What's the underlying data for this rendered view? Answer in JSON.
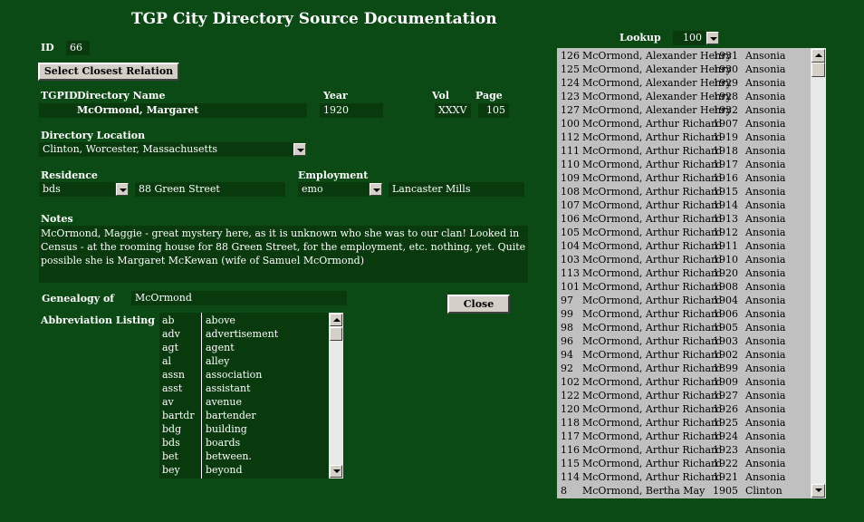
{
  "title": "TGP City Directory Source Documentation",
  "id": {
    "label": "ID",
    "value": "66"
  },
  "buttons": {
    "select_closest": "Select Closest Relation",
    "close": "Close"
  },
  "headers": {
    "tgpid": "TGPID",
    "directory_name": "Directory Name",
    "year": "Year",
    "vol": "Vol",
    "page": "Page"
  },
  "record": {
    "directory_name": "McOrmond, Margaret",
    "year": "1920",
    "vol": "XXXV",
    "page": "105"
  },
  "location": {
    "label": "Directory Location",
    "value": "Clinton, Worcester, Massachusetts"
  },
  "residence": {
    "label": "Residence",
    "type": "bds",
    "address": "88 Green Street"
  },
  "employment": {
    "label": "Employment",
    "type": "emo",
    "employer": "Lancaster Mills"
  },
  "notes": {
    "label": "Notes",
    "text": "McOrmond, Maggie - great mystery here, as it is unknown who she was to our clan! Looked in Census - at the rooming house for 88 Green Street, for the employment, etc. nothing, yet. Quite possible she is Margaret McKewan (wife of Samuel McOrmond)"
  },
  "genealogy": {
    "label": "Genealogy of",
    "value": "McOrmond"
  },
  "abbreviations": {
    "label": "Abbreviation Listing",
    "items": [
      {
        "abbr": "ab",
        "meaning": "above"
      },
      {
        "abbr": "adv",
        "meaning": "advertisement"
      },
      {
        "abbr": "agt",
        "meaning": "agent"
      },
      {
        "abbr": "al",
        "meaning": "alley"
      },
      {
        "abbr": "assn",
        "meaning": "association"
      },
      {
        "abbr": "asst",
        "meaning": "assistant"
      },
      {
        "abbr": "av",
        "meaning": "avenue"
      },
      {
        "abbr": "bartdr",
        "meaning": "bartender"
      },
      {
        "abbr": "bdg",
        "meaning": "building"
      },
      {
        "abbr": "bds",
        "meaning": "boards"
      },
      {
        "abbr": "bet",
        "meaning": "between."
      },
      {
        "abbr": "bey",
        "meaning": "beyond"
      }
    ]
  },
  "lookup": {
    "label": "Lookup",
    "value": "100",
    "rows": [
      {
        "id": "126",
        "name": "McOrmond, Alexander Henry",
        "year": "1931",
        "place": "Ansonia"
      },
      {
        "id": "125",
        "name": "McOrmond, Alexander Henry",
        "year": "1930",
        "place": "Ansonia"
      },
      {
        "id": "124",
        "name": "McOrmond, Alexander Henry",
        "year": "1929",
        "place": "Ansonia"
      },
      {
        "id": "123",
        "name": "McOrmond, Alexander Henry",
        "year": "1928",
        "place": "Ansonia"
      },
      {
        "id": "127",
        "name": "McOrmond, Alexander Henry",
        "year": "1932",
        "place": "Ansonia"
      },
      {
        "id": "100",
        "name": "McOrmond, Arthur Richard",
        "year": "1907",
        "place": "Ansonia"
      },
      {
        "id": "112",
        "name": "McOrmond, Arthur Richard",
        "year": "1919",
        "place": "Ansonia"
      },
      {
        "id": "111",
        "name": "McOrmond, Arthur Richard",
        "year": "1918",
        "place": "Ansonia"
      },
      {
        "id": "110",
        "name": "McOrmond, Arthur Richard",
        "year": "1917",
        "place": "Ansonia"
      },
      {
        "id": "109",
        "name": "McOrmond, Arthur Richard",
        "year": "1916",
        "place": "Ansonia"
      },
      {
        "id": "108",
        "name": "McOrmond, Arthur Richard",
        "year": "1915",
        "place": "Ansonia"
      },
      {
        "id": "107",
        "name": "McOrmond, Arthur Richard",
        "year": "1914",
        "place": "Ansonia"
      },
      {
        "id": "106",
        "name": "McOrmond, Arthur Richard",
        "year": "1913",
        "place": "Ansonia"
      },
      {
        "id": "105",
        "name": "McOrmond, Arthur Richard",
        "year": "1912",
        "place": "Ansonia"
      },
      {
        "id": "104",
        "name": "McOrmond, Arthur Richard",
        "year": "1911",
        "place": "Ansonia"
      },
      {
        "id": "103",
        "name": "McOrmond, Arthur Richard",
        "year": "1910",
        "place": "Ansonia"
      },
      {
        "id": "113",
        "name": "McOrmond, Arthur Richard",
        "year": "1920",
        "place": "Ansonia"
      },
      {
        "id": "101",
        "name": "McOrmond, Arthur Richard",
        "year": "1908",
        "place": "Ansonia"
      },
      {
        "id": "97",
        "name": "McOrmond, Arthur Richard",
        "year": "1904",
        "place": "Ansonia"
      },
      {
        "id": "99",
        "name": "McOrmond, Arthur Richard",
        "year": "1906",
        "place": "Ansonia"
      },
      {
        "id": "98",
        "name": "McOrmond, Arthur Richard",
        "year": "1905",
        "place": "Ansonia"
      },
      {
        "id": "96",
        "name": "McOrmond, Arthur Richard",
        "year": "1903",
        "place": "Ansonia"
      },
      {
        "id": "94",
        "name": "McOrmond, Arthur Richard",
        "year": "1902",
        "place": "Ansonia"
      },
      {
        "id": "92",
        "name": "McOrmond, Arthur Richard",
        "year": "1899",
        "place": "Ansonia"
      },
      {
        "id": "102",
        "name": "McOrmond, Arthur Richard",
        "year": "1909",
        "place": "Ansonia"
      },
      {
        "id": "122",
        "name": "McOrmond, Arthur Richard",
        "year": "1927",
        "place": "Ansonia"
      },
      {
        "id": "120",
        "name": "McOrmond, Arthur Richard",
        "year": "1926",
        "place": "Ansonia"
      },
      {
        "id": "118",
        "name": "McOrmond, Arthur Richard",
        "year": "1925",
        "place": "Ansonia"
      },
      {
        "id": "117",
        "name": "McOrmond, Arthur Richard",
        "year": "1924",
        "place": "Ansonia"
      },
      {
        "id": "116",
        "name": "McOrmond, Arthur Richard",
        "year": "1923",
        "place": "Ansonia"
      },
      {
        "id": "115",
        "name": "McOrmond, Arthur Richard",
        "year": "1922",
        "place": "Ansonia"
      },
      {
        "id": "114",
        "name": "McOrmond, Arthur Richard",
        "year": "1921",
        "place": "Ansonia"
      },
      {
        "id": "8",
        "name": "McOrmond, Bertha May",
        "year": "1905",
        "place": "Clinton"
      }
    ]
  }
}
